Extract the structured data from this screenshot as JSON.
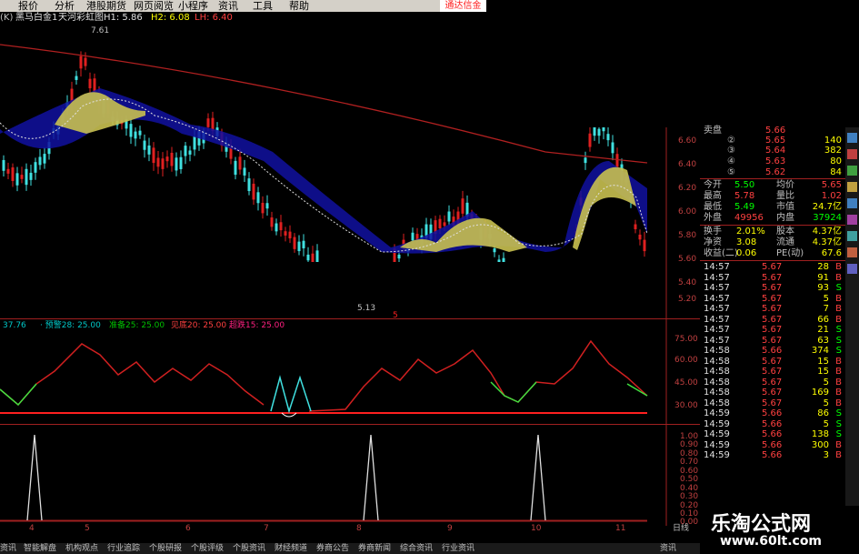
{
  "menu": {
    "items": [
      "报价",
      "分析",
      "港股期货",
      "网页阅览",
      "小程序",
      "资讯",
      "工具",
      "帮助"
    ],
    "brand": "通达信金"
  },
  "title_bar": {
    "period": "(K)",
    "stock_name": "黑马白金1",
    "indicator": "天河彩虹图H1: 5.86",
    "h2": "H2: 6.08",
    "lh": "LH: 6.40"
  },
  "main_chart": {
    "price_axis": [
      "6.60",
      "6.40",
      "6.20",
      "6.00",
      "5.80",
      "5.60",
      "5.40",
      "5.20"
    ],
    "high_label": "7.61",
    "low_label": "5.13",
    "marker_label": "5"
  },
  "indicator1": {
    "header": [
      {
        "text": "37.76",
        "color": "#00c8c8"
      },
      {
        "text": "· 预警28: 25.00",
        "color": "#00c8c8"
      },
      {
        "text": "准备25: 25.00",
        "color": "#00c000"
      },
      {
        "text": "见底20: 25.00",
        "color": "#ff4040"
      },
      {
        "text": "超跌15: 25.00",
        "color": "#ff2080"
      }
    ],
    "axis": [
      "75.00",
      "60.00",
      "45.00",
      "30.00"
    ]
  },
  "indicator2": {
    "axis": [
      "1.00",
      "0.90",
      "0.80",
      "0.70",
      "0.60",
      "0.50",
      "0.40",
      "0.30",
      "0.20",
      "0.10",
      "0.00"
    ]
  },
  "x_axis": {
    "labels": [
      "4",
      "5",
      "6",
      "7",
      "8",
      "9",
      "10",
      "11"
    ],
    "right_label": "日线"
  },
  "status_bar": {
    "items": [
      "资讯",
      "智能解盘",
      "机构观点",
      "行业追踪",
      "个股研报",
      "个股评级",
      "个股资讯",
      "财经频道",
      "券商公告",
      "券商新闻",
      "综合资讯",
      "行业资讯",
      "资讯"
    ]
  },
  "quote": {
    "asks": [
      {
        "label": "卖盘",
        "price": "5.66",
        "vol": ""
      },
      {
        "label": "②",
        "price": "5.65",
        "vol": "140"
      },
      {
        "label": "③",
        "price": "5.64",
        "vol": "382"
      },
      {
        "label": "④",
        "price": "5.63",
        "vol": "80"
      },
      {
        "label": "⑤",
        "price": "5.62",
        "vol": "84"
      }
    ],
    "stats": [
      {
        "l1": "今开",
        "v1": "5.50",
        "l2": "均价",
        "v2": "5.65",
        "c1": "#00ff00",
        "c2": "#ff4040"
      },
      {
        "l1": "最高",
        "v1": "5.78",
        "l2": "量比",
        "v2": "1.02",
        "c1": "#ff4040",
        "c2": "#ff4040"
      },
      {
        "l1": "最低",
        "v1": "5.49",
        "l2": "市值",
        "v2": "24.7亿",
        "c1": "#00ff00",
        "c2": "#ffff00"
      },
      {
        "l1": "外盘",
        "v1": "49956",
        "l2": "内盘",
        "v2": "37924",
        "c1": "#ff4040",
        "c2": "#00ff00"
      }
    ],
    "stats2": [
      {
        "l1": "换手",
        "v1": "2.01%",
        "l2": "股本",
        "v2": "4.37亿"
      },
      {
        "l1": "净资",
        "v1": "3.08",
        "l2": "流通",
        "v2": "4.37亿"
      },
      {
        "l1": "收益(二)",
        "v1": "0.06",
        "l2": "PE(动)",
        "v2": "67.6"
      }
    ],
    "ticks": [
      {
        "t": "14:57",
        "p": "5.67",
        "v": "28",
        "s": "B"
      },
      {
        "t": "14:57",
        "p": "5.67",
        "v": "91",
        "s": "B"
      },
      {
        "t": "14:57",
        "p": "5.67",
        "v": "93",
        "s": "S"
      },
      {
        "t": "14:57",
        "p": "5.67",
        "v": "5",
        "s": "B"
      },
      {
        "t": "14:57",
        "p": "5.67",
        "v": "7",
        "s": "B"
      },
      {
        "t": "14:57",
        "p": "5.67",
        "v": "66",
        "s": "B"
      },
      {
        "t": "14:57",
        "p": "5.67",
        "v": "21",
        "s": "S"
      },
      {
        "t": "14:57",
        "p": "5.67",
        "v": "63",
        "s": "S"
      },
      {
        "t": "14:58",
        "p": "5.66",
        "v": "374",
        "s": "S"
      },
      {
        "t": "14:58",
        "p": "5.67",
        "v": "15",
        "s": "B"
      },
      {
        "t": "14:58",
        "p": "5.67",
        "v": "15",
        "s": "B"
      },
      {
        "t": "14:58",
        "p": "5.67",
        "v": "5",
        "s": "B"
      },
      {
        "t": "14:58",
        "p": "5.67",
        "v": "169",
        "s": "B"
      },
      {
        "t": "14:58",
        "p": "5.67",
        "v": "5",
        "s": "B"
      },
      {
        "t": "14:59",
        "p": "5.66",
        "v": "86",
        "s": "S"
      },
      {
        "t": "14:59",
        "p": "5.66",
        "v": "5",
        "s": "S"
      },
      {
        "t": "14:59",
        "p": "5.66",
        "v": "138",
        "s": "S"
      },
      {
        "t": "14:59",
        "p": "5.66",
        "v": "300",
        "s": "B"
      },
      {
        "t": "14:59",
        "p": "5.66",
        "v": "3",
        "s": "B"
      }
    ]
  },
  "watermark": {
    "title": "乐淘公式网",
    "url": "www.60lt.com"
  }
}
